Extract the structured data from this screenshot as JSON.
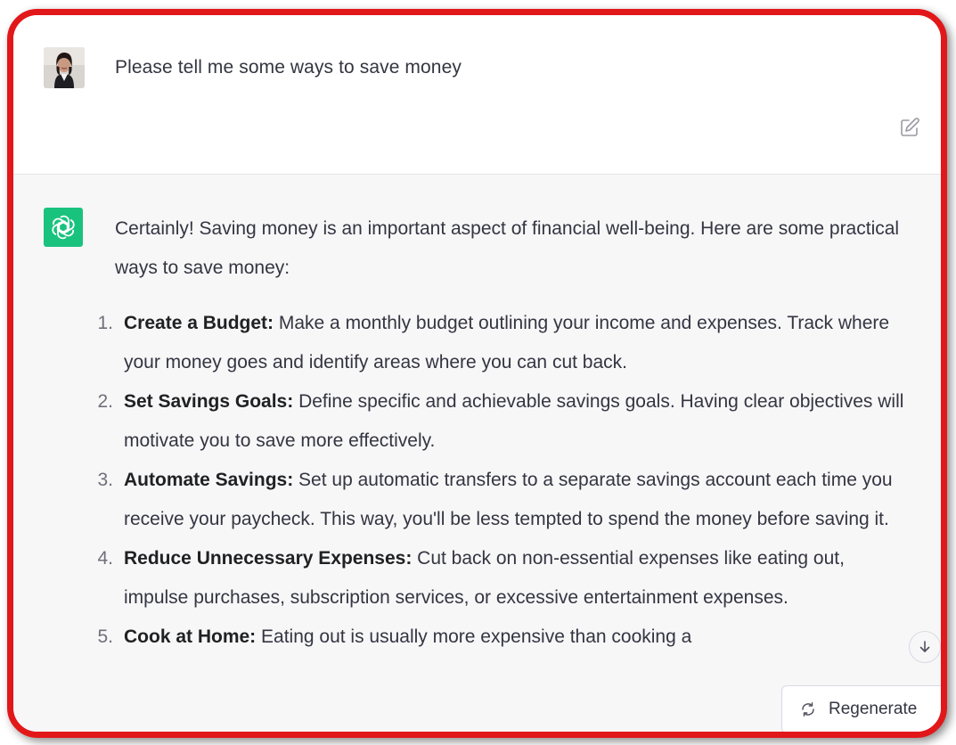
{
  "user_message": {
    "text": "Please tell me some ways to save money",
    "avatar_icon": "user-avatar-photo",
    "edit_icon": "edit-pencil-icon"
  },
  "assistant_message": {
    "avatar_icon": "openai-logo-icon",
    "intro": "Certainly! Saving money is an important aspect of financial well-being. Here are some practical ways to save money:",
    "items": [
      {
        "number": "1.",
        "title": "Create a Budget:",
        "text": " Make a monthly budget outlining your income and expenses. Track where your money goes and identify areas where you can cut back."
      },
      {
        "number": "2.",
        "title": "Set Savings Goals:",
        "text": " Define specific and achievable savings goals. Having clear objectives will motivate you to save more effectively."
      },
      {
        "number": "3.",
        "title": "Automate Savings:",
        "text": " Set up automatic transfers to a separate savings account each time you receive your paycheck. This way, you'll be less tempted to spend the money before saving it."
      },
      {
        "number": "4.",
        "title": "Reduce Unnecessary Expenses:",
        "text": " Cut back on non-essential expenses like eating out, impulse purchases, subscription services, or excessive entertainment expenses."
      },
      {
        "number": "5.",
        "title": "Cook at Home:",
        "text": " Eating out is usually more expensive than cooking a"
      }
    ]
  },
  "controls": {
    "regenerate_label": "Regenerate",
    "regenerate_icon": "refresh-icon",
    "scroll_icon": "arrow-down-icon"
  },
  "colors": {
    "frame_border": "#e2171a",
    "assistant_avatar_bg": "#19c37d",
    "assistant_row_bg": "#f7f7f8"
  }
}
